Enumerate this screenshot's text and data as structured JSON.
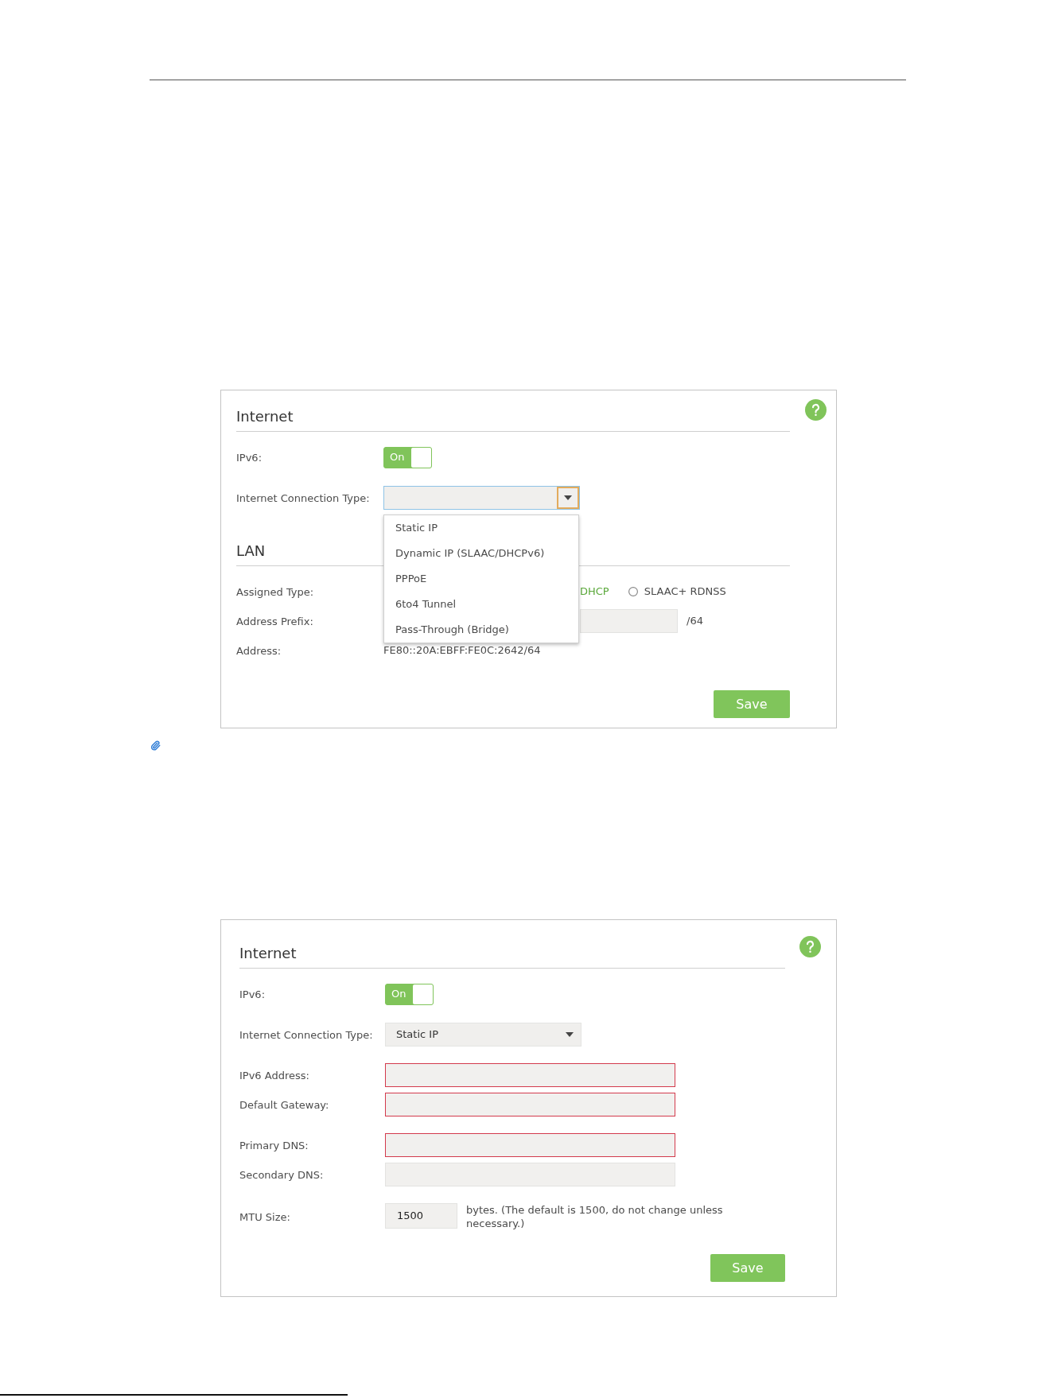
{
  "panels": [
    {
      "sections": [
        {
          "title": "Internet",
          "groups": [
            {
              "rows": [
                {
                  "kind": "toggle",
                  "label": "IPv6:",
                  "text": "On",
                  "on": true
                }
              ]
            },
            {
              "rows": [
                {
                  "kind": "select",
                  "label": "Internet Connection Type:",
                  "focused": true,
                  "expanded": true,
                  "options": [
                    {
                      "label": "Static IP",
                      "selected": false
                    },
                    {
                      "label": "Dynamic IP (SLAAC/DHCPv6)",
                      "selected": false
                    },
                    {
                      "label": "PPPoE",
                      "selected": false
                    },
                    {
                      "label": "6to4 Tunnel",
                      "selected": false
                    },
                    {
                      "label": "Pass-Through (Bridge)",
                      "selected": false
                    }
                  ]
                }
              ]
            }
          ]
        },
        {
          "title": "LAN",
          "groups": [
            {
              "rows": [
                {
                  "kind": "radio",
                  "label": "Assigned Type:",
                  "covered": true,
                  "options": [
                    {
                      "kind": "text",
                      "label": "DHCP",
                      "selected": true
                    },
                    {
                      "kind": "radio",
                      "label": "SLAAC+ RDNSS",
                      "selected": false
                    }
                  ]
                },
                {
                  "kind": "text_input",
                  "label": "Address Prefix:",
                  "covered": true,
                  "invalid": false,
                  "suffix": "/64"
                },
                {
                  "kind": "value",
                  "label": "Address:",
                  "covered": false,
                  "value": "FE80::20A:EBFF:FE0C:2642/64"
                }
              ]
            }
          ]
        }
      ],
      "save": "Save"
    },
    {
      "sections": [
        {
          "title": "Internet",
          "groups": [
            {
              "rows": [
                {
                  "kind": "toggle",
                  "label": "IPv6:",
                  "text": "On",
                  "on": true
                }
              ]
            },
            {
              "rows": [
                {
                  "kind": "select",
                  "label": "Internet Connection Type:",
                  "value": "Static IP",
                  "focused": false,
                  "expanded": false
                }
              ]
            },
            {
              "rows": [
                {
                  "kind": "text_input",
                  "label": "IPv6 Address:",
                  "invalid": true
                },
                {
                  "kind": "text_input",
                  "label": "Default Gateway:",
                  "invalid": true
                }
              ]
            },
            {
              "rows": [
                {
                  "kind": "text_input",
                  "label": "Primary DNS:",
                  "invalid": true
                },
                {
                  "kind": "text_input",
                  "label": "Secondary DNS:",
                  "invalid": false
                }
              ]
            },
            {
              "rows": [
                {
                  "kind": "text_input",
                  "label": "MTU Size:",
                  "value": "1500",
                  "invalid": false,
                  "note": "bytes. (The default is 1500, do not change unless necessary.)"
                }
              ]
            }
          ]
        }
      ],
      "save": "Save"
    }
  ]
}
